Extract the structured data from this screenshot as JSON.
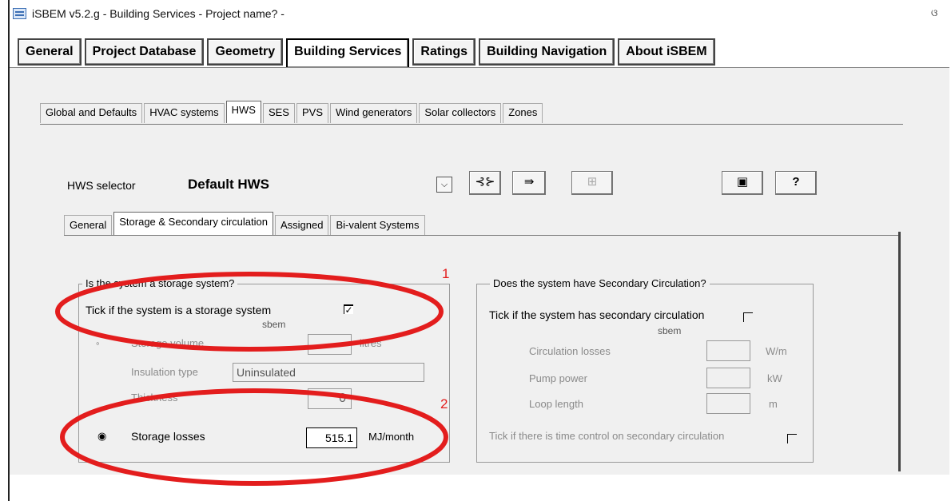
{
  "window": {
    "title": "iSBEM v5.2.g - Building Services - Project name? -",
    "close": "ଓ"
  },
  "main_tabs": [
    "General",
    "Project Database",
    "Geometry",
    "Building Services",
    "Ratings",
    "Building Navigation",
    "About iSBEM"
  ],
  "sub_tabs": [
    "Global and Defaults",
    "HVAC systems",
    "HWS",
    "SES",
    "PVS",
    "Wind generators",
    "Solar collectors",
    "Zones"
  ],
  "hws": {
    "selector_label": "HWS selector",
    "selected": "Default HWS",
    "combo_arrow": "⌵",
    "tool1": "⊰⊱",
    "tool2": "⇛",
    "tool3": "⊞",
    "tool4": "▣",
    "help": "?"
  },
  "inner_tabs": [
    "General",
    "Storage & Secondary circulation",
    "Assigned",
    "Bi-valent Systems"
  ],
  "storage": {
    "group_title": "Is the system a storage system?",
    "tick_label": "Tick if the system is a storage system",
    "tick_mark": "✓",
    "sbem": "sbem",
    "volume_label": "Storage volume",
    "volume_unit": "litres",
    "insulation_label": "Insulation type",
    "insulation_value": "Uninsulated",
    "thickness_label": "Thickness",
    "thickness_value": "0",
    "losses_label": "Storage losses",
    "losses_value": "515.1",
    "losses_unit": "MJ/month"
  },
  "secondary": {
    "group_title": "Does the system have Secondary Circulation?",
    "tick_label": "Tick if the system has secondary circulation",
    "sbem": "sbem",
    "circ_losses_label": "Circulation losses",
    "circ_losses_unit": "W/m",
    "pump_label": "Pump power",
    "pump_unit": "kW",
    "loop_label": "Loop length",
    "loop_unit": "m",
    "time_control_label": "Tick if there is time control on secondary circulation"
  },
  "annotations": {
    "marker1": "1",
    "marker2": "2",
    "color": "#e31d1d"
  }
}
